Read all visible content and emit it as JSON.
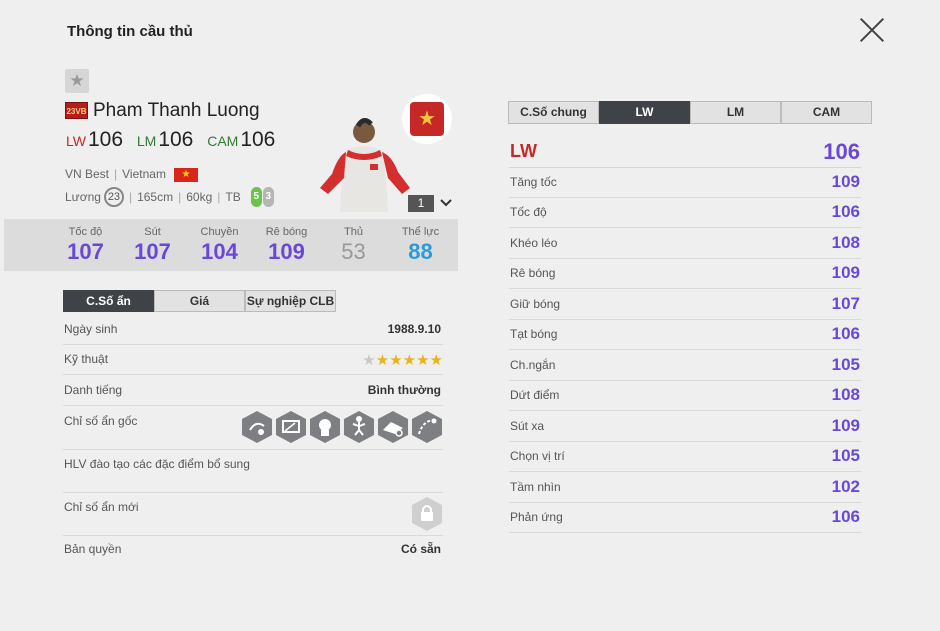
{
  "window": {
    "title": "Thông tin cầu thủ"
  },
  "player": {
    "season_badge": "23VB",
    "name": "Pham Thanh Luong",
    "positions": [
      {
        "pos": "LW",
        "value": "106"
      },
      {
        "pos": "LM",
        "value": "106"
      },
      {
        "pos": "CAM",
        "value": "106"
      }
    ],
    "team": "VN Best",
    "nation": "Vietnam",
    "salary_label": "Lương",
    "salary": "23",
    "height": "165cm",
    "weight": "60kg",
    "body": "TB",
    "left_foot": "5",
    "right_foot": "3",
    "level": "1",
    "stats": [
      {
        "label": "Tốc độ",
        "value": "107"
      },
      {
        "label": "Sút",
        "value": "107"
      },
      {
        "label": "Chuyền",
        "value": "104"
      },
      {
        "label": "Rê bóng",
        "value": "109"
      },
      {
        "label": "Thủ",
        "value": "53"
      },
      {
        "label": "Thể lực",
        "value": "88"
      }
    ]
  },
  "left_tabs": [
    "C.Số ẩn",
    "Giá",
    "Sự nghiệp CLB"
  ],
  "info": {
    "birthday_label": "Ngày sinh",
    "birthday": "1988.9.10",
    "skill_label": "Kỹ thuật",
    "skill_stars": 5,
    "reputation_label": "Danh tiếng",
    "reputation": "Bình thường",
    "hidden_label": "Chỉ số ẩn gốc",
    "coach_label": "HLV đào tạo các đặc điểm bổ sung",
    "new_hidden_label": "Chỉ số ẩn mới",
    "license_label": "Bản quyền",
    "license": "Có sẵn"
  },
  "right_tabs": [
    "C.Số chung",
    "LW",
    "LM",
    "CAM"
  ],
  "right_stats": {
    "head": {
      "label": "LW",
      "value": "106"
    },
    "rows": [
      {
        "label": "Tăng tốc",
        "value": "109"
      },
      {
        "label": "Tốc độ",
        "value": "106"
      },
      {
        "label": "Khéo léo",
        "value": "108"
      },
      {
        "label": "Rê bóng",
        "value": "109"
      },
      {
        "label": "Giữ bóng",
        "value": "107"
      },
      {
        "label": "Tạt bóng",
        "value": "106"
      },
      {
        "label": "Ch.ngắn",
        "value": "105"
      },
      {
        "label": "Dứt điểm",
        "value": "108"
      },
      {
        "label": "Sút xa",
        "value": "109"
      },
      {
        "label": "Chọn vị trí",
        "value": "105"
      },
      {
        "label": "Tầm nhìn",
        "value": "102"
      },
      {
        "label": "Phản ứng",
        "value": "106"
      }
    ]
  },
  "colors": {
    "accent": "#6a48d7",
    "tab_active": "#3f4348",
    "position_red": "#c62828",
    "position_green": "#2e7d32"
  }
}
